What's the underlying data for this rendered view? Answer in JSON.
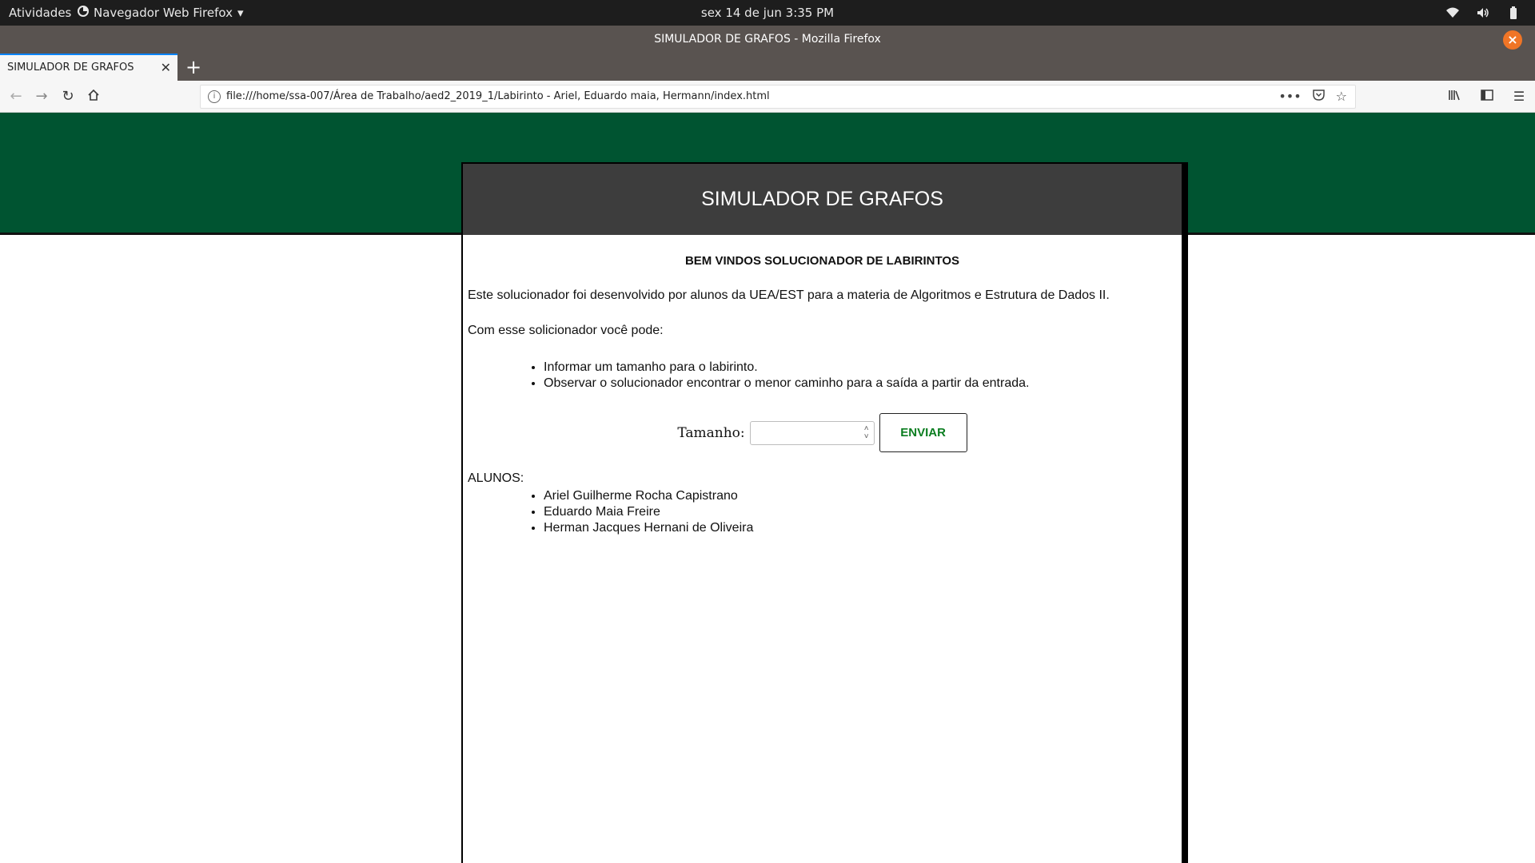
{
  "system_bar": {
    "activities": "Atividades",
    "app_menu": "Navegador Web Firefox",
    "clock": "sex 14 de jun   3:35 PM"
  },
  "window": {
    "title": "SIMULADOR DE GRAFOS - Mozilla Firefox"
  },
  "tabs": [
    {
      "label": "SIMULADOR DE GRAFOS",
      "active": true
    }
  ],
  "navbar": {
    "url": "file:///home/ssa-007/Área de Trabalho/aed2_2019_1/Labirinto - Ariel, Eduardo maia, Hermann/index.html"
  },
  "page": {
    "header_title": "SIMULADOR DE GRAFOS",
    "welcome": "BEM VINDOS SOLUCIONADOR DE LABIRINTOS",
    "intro": "Este solucionador foi desenvolvido por alunos da UEA/EST para a materia de Algoritmos e Estrutura de Dados II.",
    "features_title": "Com esse solicionador você pode:",
    "features": [
      "Informar um tamanho para o labirinto.",
      "Observar o solucionador encontrar o menor caminho para a saída a partir da entrada."
    ],
    "form": {
      "label": "Tamanho:",
      "value": "",
      "submit_label": "ENVIAR"
    },
    "students_title": "ALUNOS:",
    "students": [
      "Ariel Guilherme Rocha Capistrano",
      "Eduardo Maia Freire",
      "Herman Jacques Hernani de Oliveira"
    ]
  },
  "colors": {
    "header_green": "#005431",
    "card_header": "#3d3d3d",
    "submit_text": "#0a7d1f",
    "tab_accent": "#0a84ff",
    "close_button": "#f07526"
  }
}
